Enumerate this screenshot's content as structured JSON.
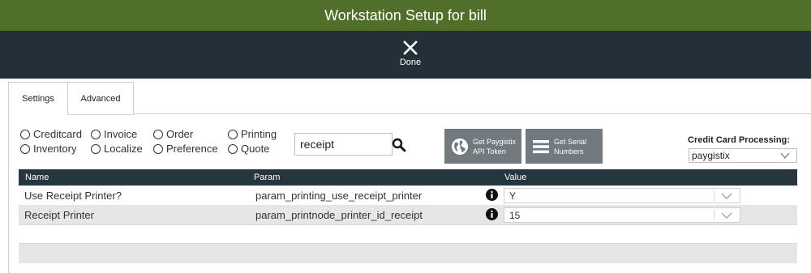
{
  "window": {
    "title": "Workstation Setup for bill"
  },
  "toolbar": {
    "done_label": "Done"
  },
  "tabs": [
    {
      "label": "Settings",
      "active": true
    },
    {
      "label": "Advanced",
      "active": false
    }
  ],
  "filters": [
    {
      "label": "Creditcard"
    },
    {
      "label": "Invoice"
    },
    {
      "label": "Order"
    },
    {
      "label": "Printing"
    },
    {
      "label": "Inventory"
    },
    {
      "label": "Localize"
    },
    {
      "label": "Preference"
    },
    {
      "label": "Quote"
    }
  ],
  "search": {
    "value": "receipt"
  },
  "buttons": {
    "paygistix_line1": "Get Paygistix",
    "paygistix_line2": "API Token",
    "serial_line1": "Get Serial",
    "serial_line2": "Numbers"
  },
  "credit_card": {
    "label": "Credit Card Processing:",
    "selected": "paygistix"
  },
  "table": {
    "headers": {
      "name": "Name",
      "param": "Param",
      "value": "Value"
    },
    "rows": [
      {
        "name": "Use Receipt Printer?",
        "param": "param_printing_use_receipt_printer",
        "value": "Y"
      },
      {
        "name": "Receipt Printer",
        "param": "param_printnode_printer_id_receipt",
        "value": "15"
      }
    ]
  },
  "colors": {
    "title_bar": "#4f6f2a",
    "toolbar": "#243038",
    "table_header": "#263640",
    "button": "#707a7f"
  },
  "icons": [
    "close-icon",
    "search-icon",
    "globe-icon",
    "list-icon",
    "chevron-down-icon",
    "info-icon"
  ]
}
